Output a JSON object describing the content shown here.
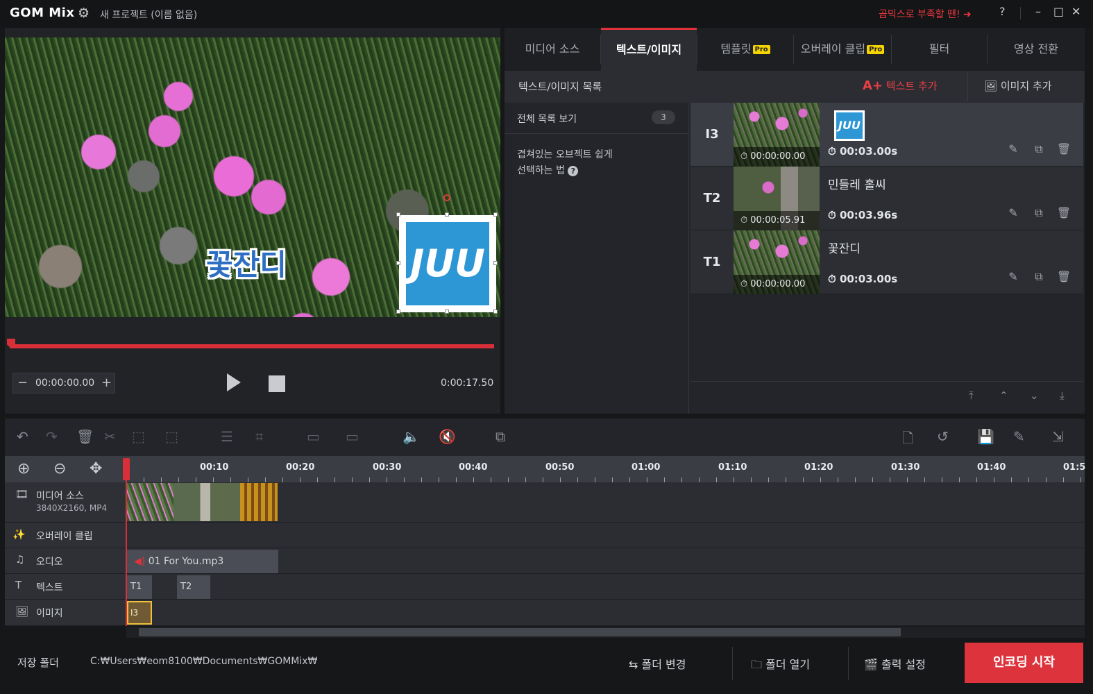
{
  "titlebar": {
    "logo": "GOM Mix",
    "project_title": "새 프로젝트 (이름 없음)",
    "promo": "곰믹스로 부족할 땐! ➜",
    "help": "?"
  },
  "preview": {
    "overlay_text": "꽃잔디",
    "logo_text": "JUU",
    "current_time": "00:00:00.00",
    "duration": "0:00:17.50"
  },
  "tabs": [
    {
      "label": "미디어 소스",
      "pro": false
    },
    {
      "label": "텍스트/이미지",
      "pro": false
    },
    {
      "label": "템플릿",
      "pro": true
    },
    {
      "label": "오버레이 클립",
      "pro": true
    },
    {
      "label": "필터",
      "pro": false
    },
    {
      "label": "영상 전환",
      "pro": false
    }
  ],
  "pro_badge": "Pro",
  "panel": {
    "list_title": "텍스트/이미지 목록",
    "add_text": "텍스트 추가",
    "add_image": "이미지 추가",
    "view_all": "전체 목록 보기",
    "count": "3",
    "help_line1": "겹쳐있는 오브젝트 쉽게",
    "help_line2": "선택하는 법"
  },
  "items": [
    {
      "id": "I3",
      "start": "00:00:00.00",
      "title": "",
      "duration": "00:03.00s"
    },
    {
      "id": "T2",
      "start": "00:00:05.91",
      "title": "민들레 홀씨",
      "duration": "00:03.96s"
    },
    {
      "id": "T1",
      "start": "00:00:00.00",
      "title": "꽃잔디",
      "duration": "00:03.00s"
    }
  ],
  "timeline": {
    "ruler": [
      "00:10",
      "00:20",
      "00:30",
      "00:40",
      "00:50",
      "01:00",
      "01:10",
      "01:20",
      "01:30",
      "01:40",
      "01:5"
    ],
    "tracks": {
      "media": {
        "name": "미디어 소스",
        "sub": "3840X2160, MP4"
      },
      "overlay": {
        "name": "오버레이 클립"
      },
      "audio": {
        "name": "오디오",
        "clip": "01 For You.mp3"
      },
      "text": {
        "name": "텍스트",
        "clips": [
          "T1",
          "T2"
        ]
      },
      "image": {
        "name": "이미지",
        "clip": "I3"
      }
    }
  },
  "footer": {
    "save_label": "저장 폴더",
    "save_path": "C:₩Users₩eom8100₩Documents₩GOMMix₩",
    "change_folder": "폴더 변경",
    "open_folder": "폴더 열기",
    "output_settings": "출력 설정",
    "encode": "인코딩 시작"
  },
  "colors": {
    "accent": "#dd333c",
    "pro": "#f5d400",
    "logo_blue": "#2d97d6"
  }
}
